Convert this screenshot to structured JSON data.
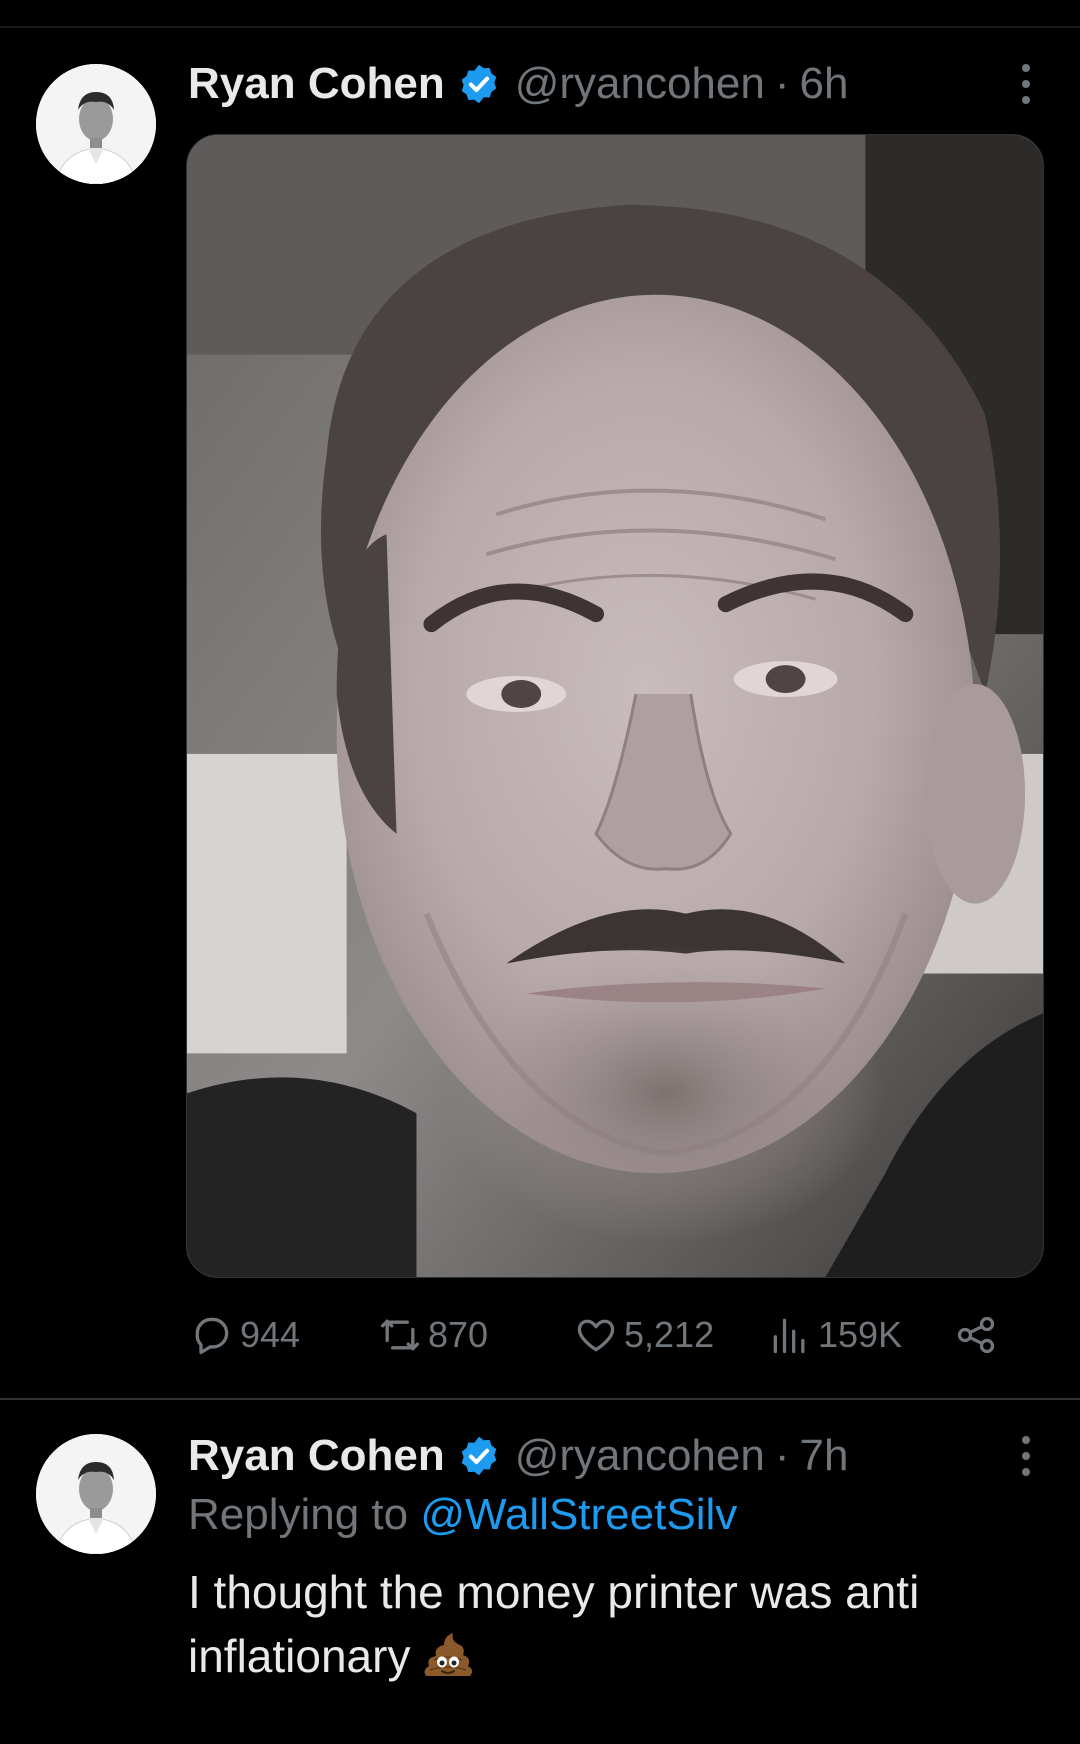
{
  "tweets": [
    {
      "author_name": "Ryan Cohen",
      "handle": "@ryancohen",
      "separator": "·",
      "time": "6h",
      "stats": {
        "replies": "944",
        "retweets": "870",
        "likes": "5,212",
        "views": "159K"
      }
    },
    {
      "author_name": "Ryan Cohen",
      "handle": "@ryancohen",
      "separator": "·",
      "time": "7h",
      "replying_prefix": "Replying to",
      "replying_to": "@WallStreetSilv",
      "text": "I thought the money printer was anti inflationary",
      "emoji": "poo-emoji"
    }
  ],
  "colors": {
    "background": "#000000",
    "text": "#e7e9ea",
    "secondary": "#71767b",
    "accent": "#1d9bf0",
    "divider": "#2f3336"
  },
  "icons": [
    "verified-badge-icon",
    "more-options-icon",
    "reply-icon",
    "retweet-icon",
    "like-icon",
    "views-icon",
    "share-icon"
  ]
}
